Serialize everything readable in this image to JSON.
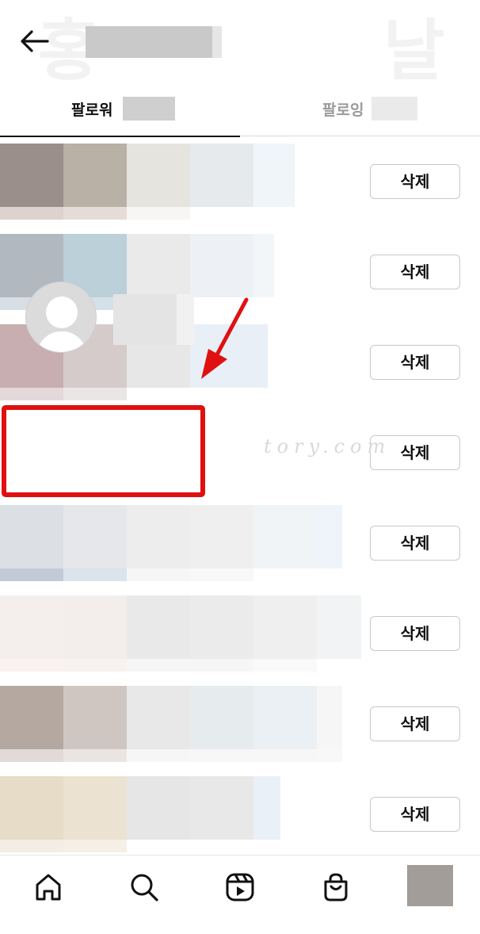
{
  "header": {
    "ghost_left": "홍",
    "ghost_right": "날",
    "back_icon": "arrow-left-icon"
  },
  "tabs": [
    {
      "label": "팔로워",
      "active": true
    },
    {
      "label": "팔로잉",
      "active": false
    }
  ],
  "rows": [
    {
      "delete_label": "삭제"
    },
    {
      "delete_label": "삭제"
    },
    {
      "delete_label": "삭제"
    },
    {
      "delete_label": "삭제",
      "highlighted": true,
      "avatar": "default-avatar-icon"
    },
    {
      "delete_label": "삭제"
    },
    {
      "delete_label": "삭제"
    },
    {
      "delete_label": "삭제"
    },
    {
      "delete_label": "삭제"
    }
  ],
  "watermark": "tory.com",
  "bottom_nav": [
    "home-icon",
    "search-icon",
    "reels-icon",
    "shop-icon",
    "profile-avatar"
  ],
  "colors": {
    "highlight": "#e01010",
    "arrow": "#e01010",
    "active_tab": "#111111",
    "inactive_tab": "#9a9a9a"
  }
}
